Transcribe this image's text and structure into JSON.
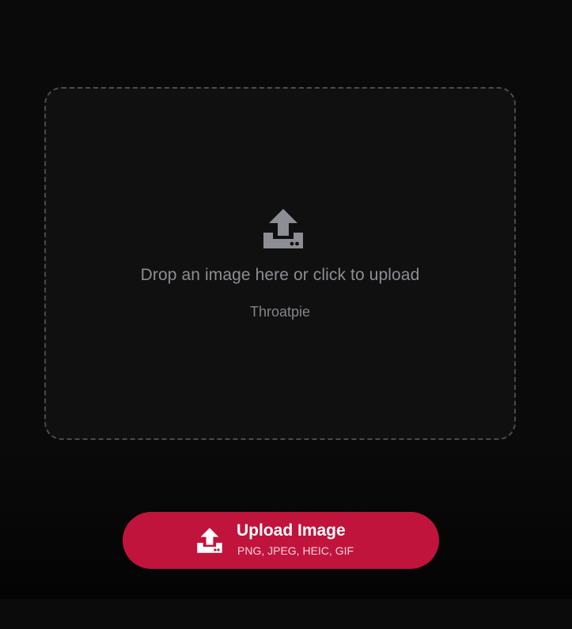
{
  "dropzone": {
    "title": "Drop an image here or click to upload",
    "subtitle": "Throatpie",
    "icon": "upload-tray-icon"
  },
  "upload_button": {
    "label": "Upload Image",
    "formats": "PNG, JPEG, HEIC, GIF",
    "icon": "upload-tray-icon"
  },
  "colors": {
    "accent": "#c0143c",
    "icon_gray": "#8d8d94",
    "background": "#0a0a0a"
  }
}
